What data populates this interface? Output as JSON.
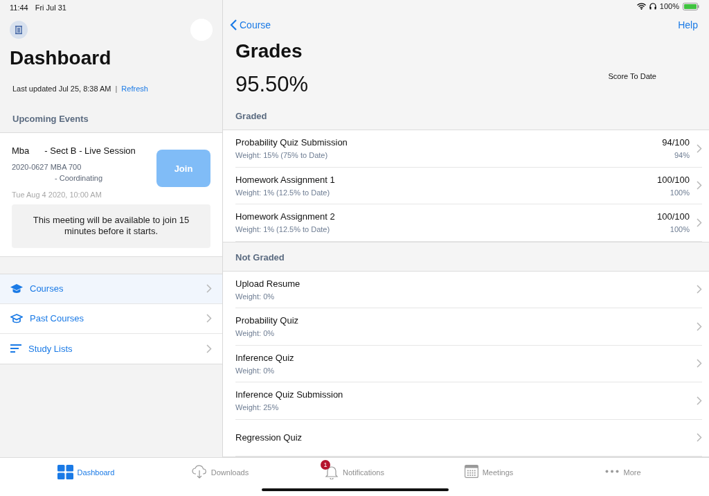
{
  "status_bar": {
    "time": "11:44",
    "date": "Fri Jul 31",
    "battery": "100%"
  },
  "sidebar": {
    "title": "Dashboard",
    "last_updated": "Last updated Jul 25, 8:38 AM",
    "separator": "|",
    "refresh": "Refresh",
    "events_header": "Upcoming Events",
    "event": {
      "title_start": "Mba",
      "title_end": "- Sect B - Live Session",
      "course": "2020-0627 MBA 700",
      "role": "- Coordinating",
      "time": "Tue Aug 4 2020, 10:00 AM",
      "join": "Join",
      "join_disabled": true,
      "notice": "This meeting will be available to join 15 minutes before it starts."
    },
    "items": [
      {
        "label": "Courses",
        "kind": "courses",
        "selected": true
      },
      {
        "label": "Past Courses",
        "kind": "past",
        "selected": false
      },
      {
        "label": "Study Lists",
        "kind": "lists",
        "selected": false
      }
    ]
  },
  "nav": {
    "back": "Course",
    "help": "Help"
  },
  "grades": {
    "title": "Grades",
    "score": "95.50%",
    "score_label": "Score To Date",
    "sections": [
      {
        "header": "Graded",
        "rows": [
          {
            "title": "Probability Quiz Submission",
            "weight": "Weight: 15% (75% to Date)",
            "score": "94/100",
            "percent": "94%"
          },
          {
            "title": "Homework Assignment 1",
            "weight": "Weight: 1% (12.5% to Date)",
            "score": "100/100",
            "percent": "100%"
          },
          {
            "title": "Homework Assignment 2",
            "weight": "Weight: 1% (12.5% to Date)",
            "score": "100/100",
            "percent": "100%"
          }
        ]
      },
      {
        "header": "Not Graded",
        "rows": [
          {
            "title": "Upload Resume",
            "weight": "Weight: 0%"
          },
          {
            "title": "Probability Quiz",
            "weight": "Weight: 0%"
          },
          {
            "title": "Inference Quiz",
            "weight": "Weight: 0%"
          },
          {
            "title": "Inference Quiz Submission",
            "weight": "Weight: 25%"
          },
          {
            "title": "Regression Quiz"
          }
        ]
      }
    ]
  },
  "tab_bar": [
    {
      "label": "Dashboard",
      "kind": "dashboard",
      "selected": true
    },
    {
      "label": "Downloads",
      "kind": "downloads",
      "selected": false
    },
    {
      "label": "Notifications",
      "kind": "notifications",
      "selected": false,
      "badge": "1"
    },
    {
      "label": "Meetings",
      "kind": "meetings",
      "selected": false
    },
    {
      "label": "More",
      "kind": "more",
      "selected": false
    }
  ]
}
